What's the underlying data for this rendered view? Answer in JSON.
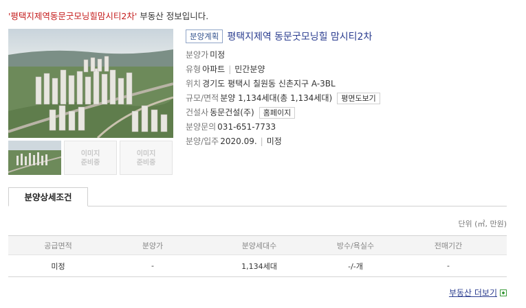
{
  "headline": {
    "quoted_name": "'평택지제역동문굿모닝힐맘시티2차'",
    "suffix": " 부동산 정보입니다."
  },
  "gallery": {
    "placeholder_text_line1": "이미지",
    "placeholder_text_line2": "준비중"
  },
  "project": {
    "status_badge": "분양계획",
    "name": "평택지제역 동문굿모닝힐 맘시티2차",
    "details": {
      "price_label": "분양가",
      "price_value": "미정",
      "type_label": "유형",
      "type_value_1": "아파트",
      "type_value_2": "민간분양",
      "location_label": "위치",
      "location_value": "경기도 평택시 칠원동 신촌지구 A-3BL",
      "scale_label": "규모/면적",
      "scale_value": "분양 1,134세대(총 1,134세대)",
      "floorplan_button": "평면도보기",
      "builder_label": "건설사",
      "builder_value": "동문건설(주)",
      "homepage_button": "홈페이지",
      "contact_label": "분양문의",
      "contact_value": "031-651-7733",
      "schedule_label": "분양/입주",
      "schedule_sale": "2020.09.",
      "schedule_move": "미정"
    }
  },
  "tabs": {
    "active_label": "분양상세조건"
  },
  "unit_note": "단위 (㎡, 만원)",
  "conditions_table": {
    "headers": [
      "공급면적",
      "분양가",
      "분양세대수",
      "방수/욕실수",
      "전매기간"
    ],
    "rows": [
      [
        "미정",
        "-",
        "1,134세대",
        "-/-개",
        "-"
      ]
    ]
  },
  "more_link": "부동산 더보기",
  "colors": {
    "headline_quote": "#c41b1b",
    "title_blue": "#2a3c8f",
    "badge_border": "#8fa4c7",
    "plus_green": "#3a9a3a"
  }
}
